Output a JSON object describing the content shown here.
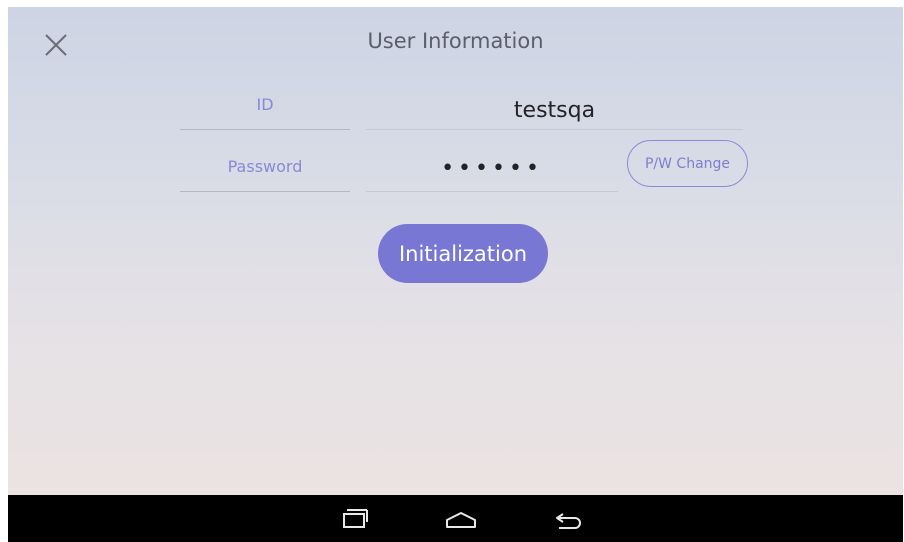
{
  "header": {
    "title": "User Information",
    "close_icon": "close-icon"
  },
  "form": {
    "id_label": "ID",
    "id_value": "testsqa",
    "password_label": "Password",
    "password_value": "••••••",
    "pw_change_label": "P/W Change"
  },
  "actions": {
    "initialization_label": "Initialization"
  },
  "navbar": {
    "icons": [
      "recent-apps-icon",
      "home-icon",
      "back-icon"
    ]
  },
  "colors": {
    "accent": "#7877d4",
    "label": "#8a89d4",
    "title": "#5b5f6a",
    "navbar": "#000000"
  }
}
